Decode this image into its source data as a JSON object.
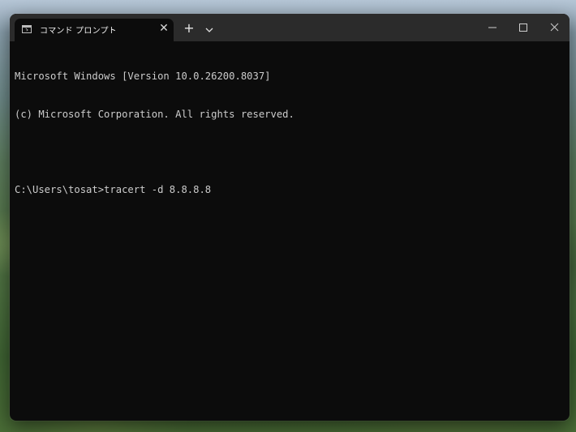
{
  "window": {
    "tab_title": "コマンド プロンプト",
    "tab_icon": "terminal-icon",
    "new_tab_label": "+",
    "close_tab_glyph": "✕"
  },
  "controls": {
    "minimize_icon": "minimize-icon",
    "maximize_icon": "maximize-icon",
    "close_icon": "close-icon",
    "dropdown_icon": "chevron-down-icon"
  },
  "terminal": {
    "lines": [
      "Microsoft Windows [Version 10.0.26200.8037]",
      "(c) Microsoft Corporation. All rights reserved.",
      "",
      "C:\\Users\\tosat>tracert -d 8.8.8.8"
    ]
  },
  "colors": {
    "terminal_background": "#0c0c0c",
    "terminal_foreground": "#cccccc",
    "titlebar_background": "#2b2b2b"
  }
}
